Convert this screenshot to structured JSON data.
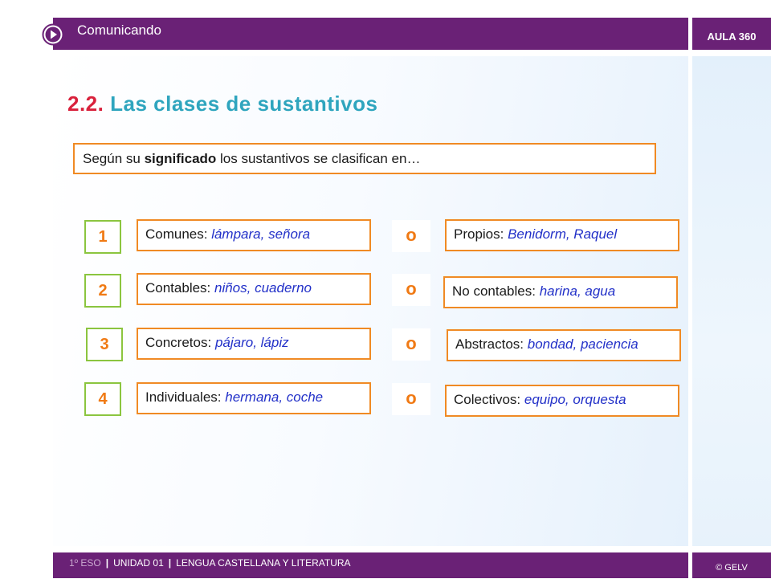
{
  "header": {
    "title": "Comunicando",
    "brand": "AULA 360",
    "play_icon": "play-circle-icon",
    "colors": {
      "bar": "#6a2176",
      "text": "#ffffff"
    }
  },
  "slide": {
    "title_number": "2.2.",
    "title_text": "Las clases de sustantivos",
    "intro": {
      "before": "Según su ",
      "bold": "significado",
      "after": " los sustantivos se clasifican en…"
    },
    "connector": "o",
    "rows": [
      {
        "number": "1",
        "left": {
          "label": "Comunes: ",
          "examples": "lámpara, señora"
        },
        "right": {
          "label": "Propios: ",
          "examples": "Benidorm, Raquel"
        }
      },
      {
        "number": "2",
        "left": {
          "label": "Contables: ",
          "examples": "niños, cuaderno"
        },
        "right": {
          "label": "No contables: ",
          "examples": "harina, agua"
        }
      },
      {
        "number": "3",
        "left": {
          "label": "Concretos: ",
          "examples": "pájaro, lápiz"
        },
        "right": {
          "label": "Abstractos: ",
          "examples": "bondad, paciencia"
        }
      },
      {
        "number": "4",
        "left": {
          "label": "Individuales: ",
          "examples": "hermana, coche"
        },
        "right": {
          "label": "Colectivos: ",
          "examples": "equipo, orquesta"
        }
      }
    ],
    "colors": {
      "title_number": "#d9213c",
      "title_text": "#2fa5be",
      "box_border": "#f08a24",
      "number_border": "#8bc53f",
      "number_text": "#f07a14",
      "examples": "#2230c8"
    }
  },
  "footer": {
    "level": "1º ESO",
    "separator": "|",
    "unit": "UNIDAD 01",
    "subject": "LENGUA CASTELLANA Y LITERATURA",
    "copyright": "© GELV"
  }
}
